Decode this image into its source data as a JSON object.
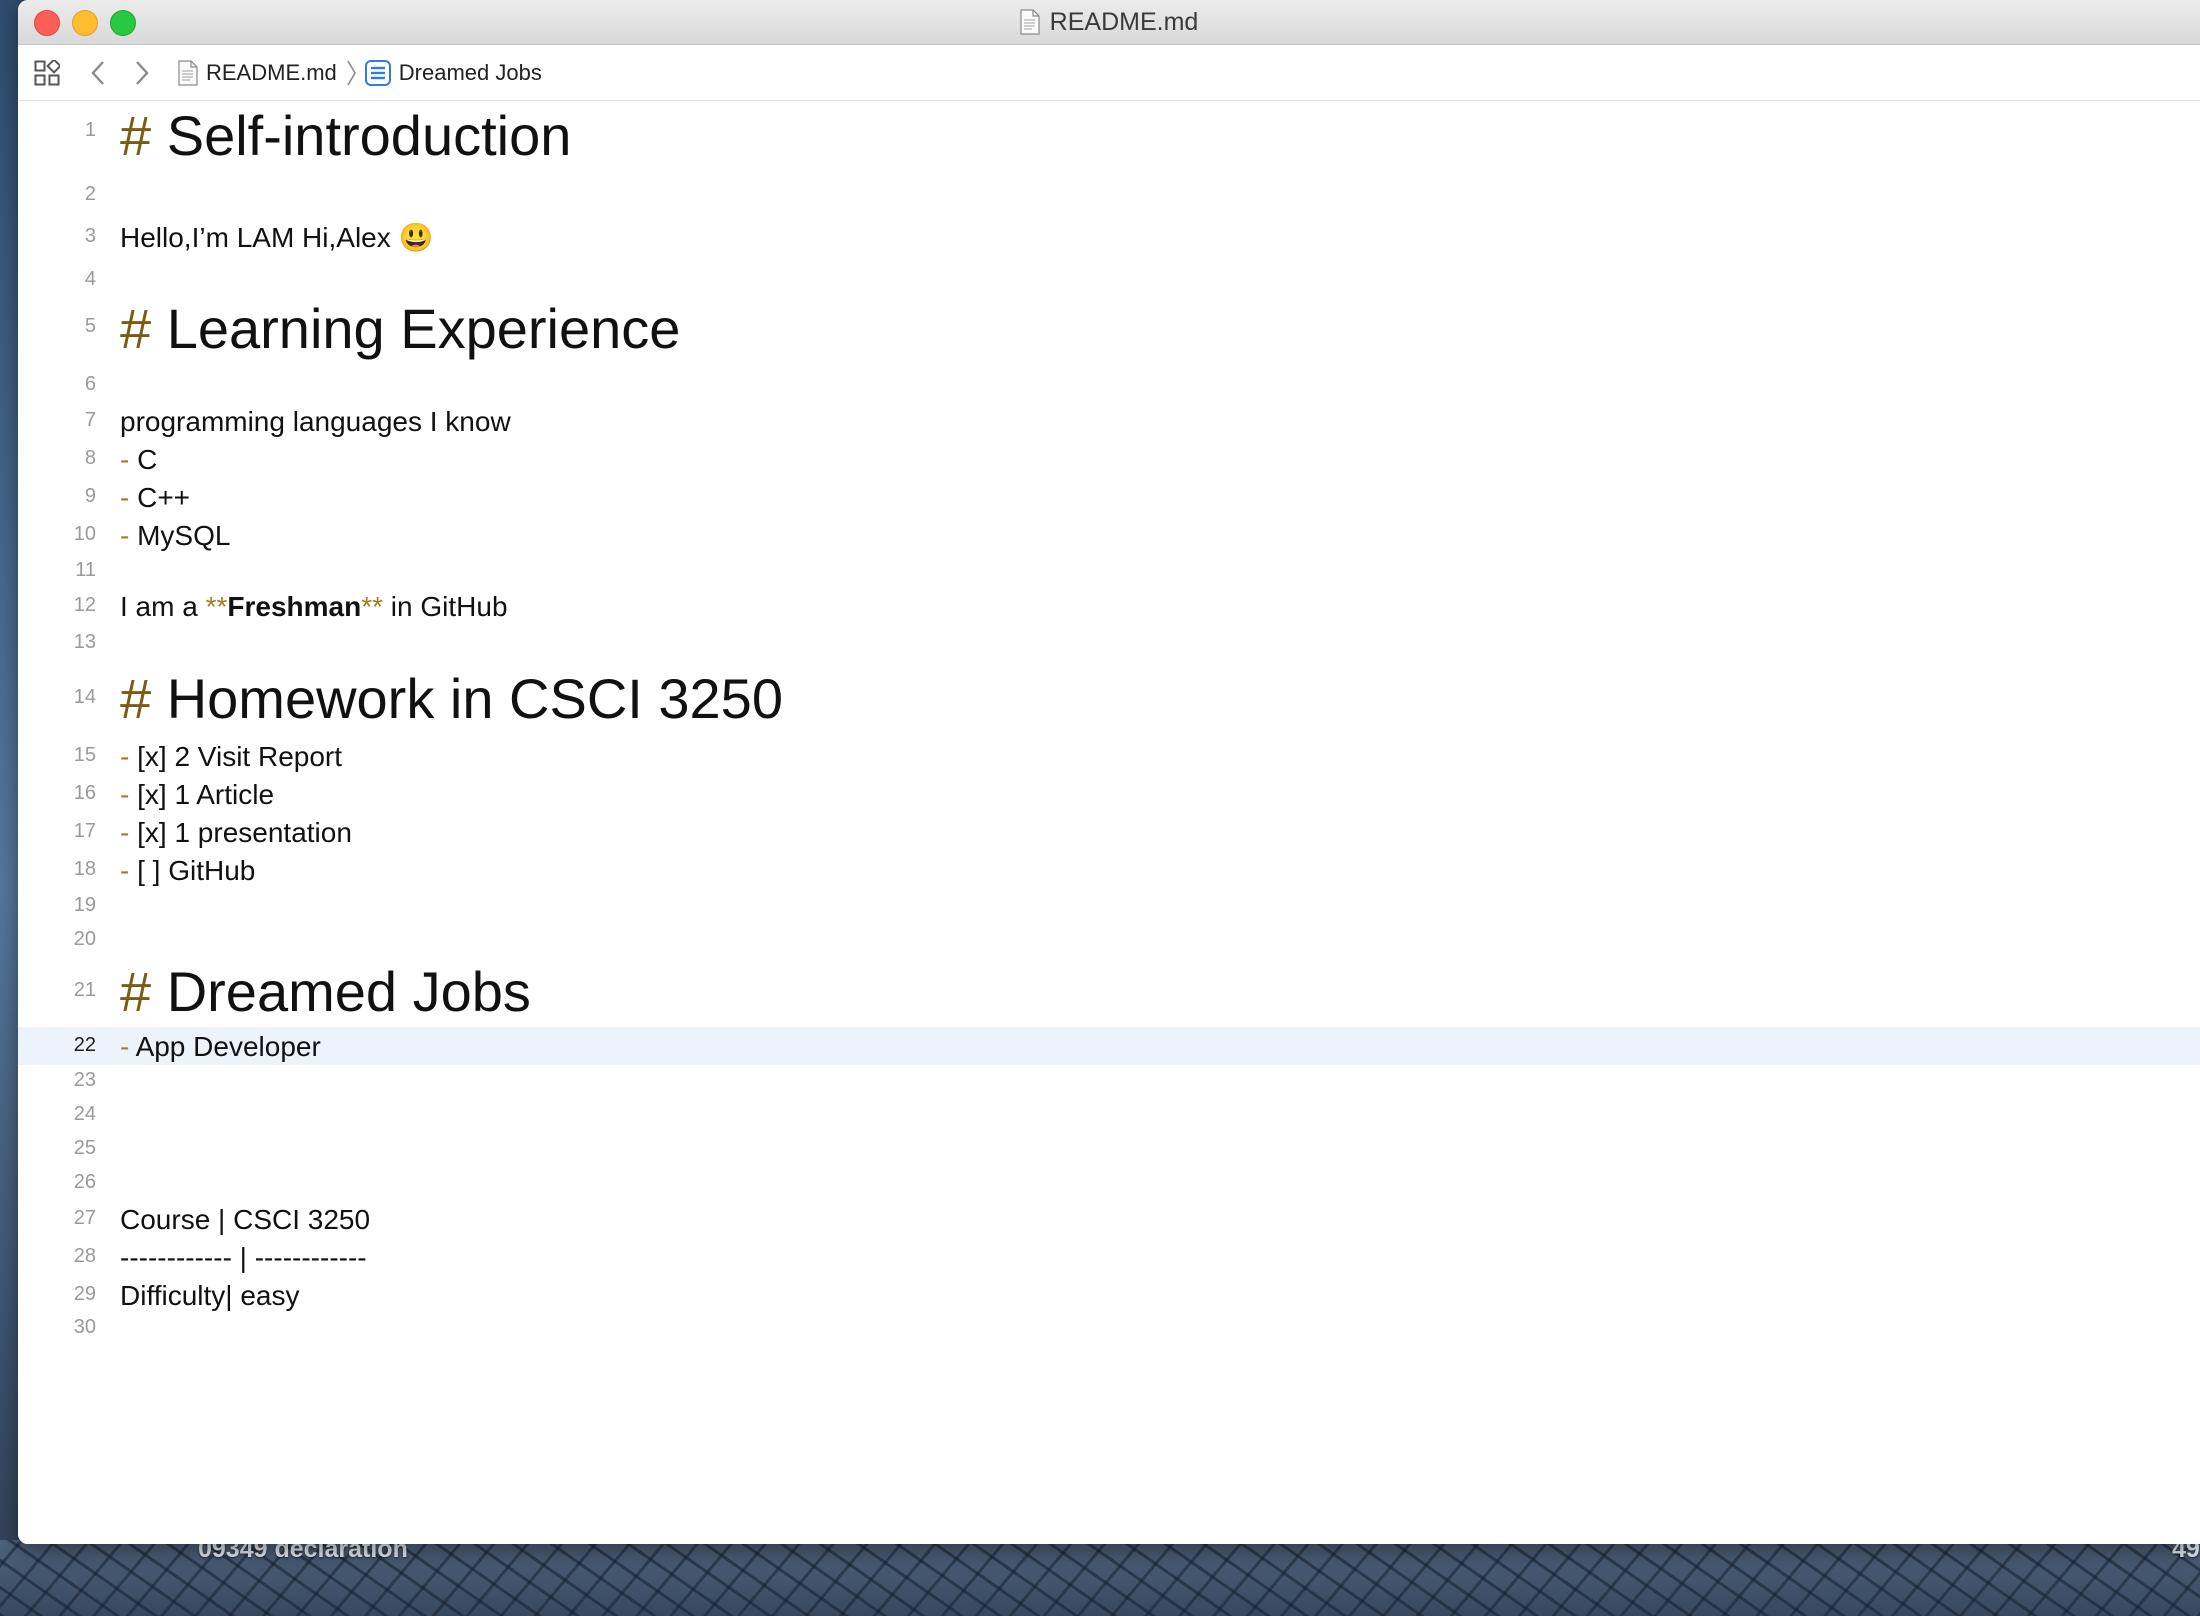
{
  "window": {
    "title": "README.md"
  },
  "navbar": {
    "breadcrumb_file": "README.md",
    "breadcrumb_section": "Dreamed Jobs"
  },
  "desktop": {
    "label": "09349 declaration",
    "label_right": "49"
  },
  "editor": {
    "current_line": 22,
    "lines": {
      "1": {
        "n": "1",
        "hash": "#",
        "text": "Self-introduction"
      },
      "2": {
        "n": "2"
      },
      "3": {
        "n": "3",
        "text": "Hello,I’m LAM Hi,Alex",
        "emoji": "😃"
      },
      "4": {
        "n": "4"
      },
      "5": {
        "n": "5",
        "hash": "#",
        "text": "Learning Experience"
      },
      "6": {
        "n": "6"
      },
      "7": {
        "n": "7",
        "text": "programming languages I know"
      },
      "8": {
        "n": "8",
        "dash": "-",
        "text": "C"
      },
      "9": {
        "n": "9",
        "dash": "-",
        "text": "C++"
      },
      "10": {
        "n": "10",
        "dash": "-",
        "text": "MySQL"
      },
      "11": {
        "n": "11"
      },
      "12": {
        "n": "12",
        "before": "I am a ",
        "open": "**",
        "bold": "Freshman",
        "close": "**",
        "after": " in GitHub"
      },
      "13": {
        "n": "13"
      },
      "14": {
        "n": "14",
        "hash": "#",
        "text": "Homework in CSCI 3250"
      },
      "15": {
        "n": "15",
        "dash": "-",
        "text": "[x] 2 Visit Report"
      },
      "16": {
        "n": "16",
        "dash": "-",
        "text": "[x] 1 Article"
      },
      "17": {
        "n": "17",
        "dash": "-",
        "text": "[x] 1 presentation"
      },
      "18": {
        "n": "18",
        "dash": "-",
        "text": "[ ] GitHub"
      },
      "19": {
        "n": "19"
      },
      "20": {
        "n": "20"
      },
      "21": {
        "n": "21",
        "hash": "#",
        "text": "Dreamed Jobs"
      },
      "22": {
        "n": "22",
        "dash": "-",
        "text": "App Developer"
      },
      "23": {
        "n": "23"
      },
      "24": {
        "n": "24"
      },
      "25": {
        "n": "25"
      },
      "26": {
        "n": "26"
      },
      "27": {
        "n": "27",
        "text": "Course | CSCI 3250"
      },
      "28": {
        "n": "28",
        "text": "------------ | ------------"
      },
      "29": {
        "n": "29",
        "text": "Difficulty| easy"
      },
      "30": {
        "n": "30"
      }
    }
  }
}
